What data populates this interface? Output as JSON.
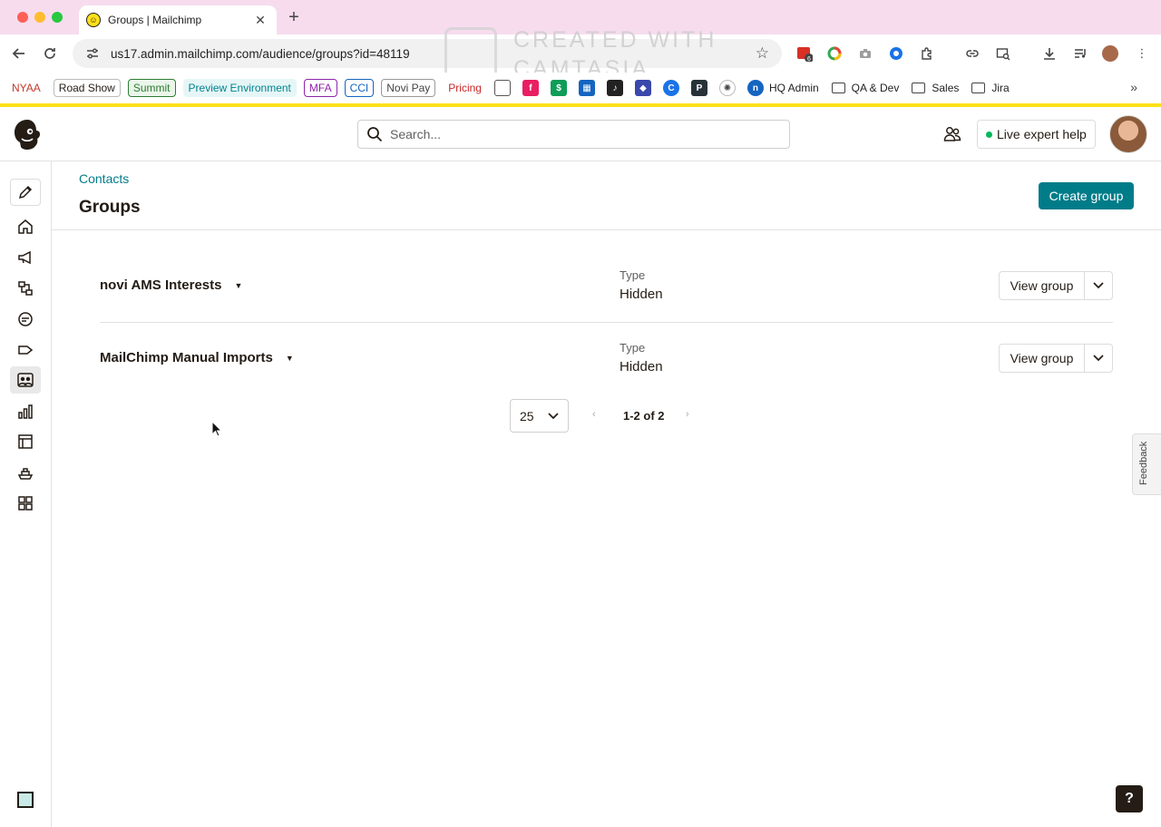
{
  "browser": {
    "tab_title": "Groups | Mailchimp",
    "url": "us17.admin.mailchimp.com/audience/groups?id=48119",
    "watermark_line1": "CREATED WITH",
    "watermark_line2": "CAMTASIA",
    "ext_badge": "6",
    "bookmarks": [
      {
        "label": "NYAA",
        "color": "#c0392b"
      },
      {
        "label": "Road Show",
        "color": "#241c15"
      },
      {
        "label": "Summit",
        "color": "#2e7d32"
      },
      {
        "label": "Preview Environment",
        "color": "#00838f"
      },
      {
        "label": "MFA",
        "color": "#8e24aa"
      },
      {
        "label": "CCI",
        "color": "#1565c0"
      },
      {
        "label": "Novi Pay",
        "color": "#424242"
      },
      {
        "label": "Pricing",
        "color": "#c62828"
      }
    ],
    "bookmark_folders": [
      "HQ Admin",
      "QA & Dev",
      "Sales",
      "Jira"
    ]
  },
  "header": {
    "search_placeholder": "Search...",
    "expert_help_label": "Live expert help"
  },
  "page": {
    "breadcrumb": "Contacts",
    "title": "Groups",
    "create_button": "Create group"
  },
  "groups": [
    {
      "name": "novi AMS Interests",
      "type_label": "Type",
      "type_value": "Hidden",
      "view_label": "View group"
    },
    {
      "name": "MailChimp Manual Imports",
      "type_label": "Type",
      "type_value": "Hidden",
      "view_label": "View group"
    }
  ],
  "pagination": {
    "per_page": "25",
    "range": "1-2 of 2"
  },
  "feedback_label": "Feedback",
  "help_label": "?",
  "colors": {
    "brand_teal": "#007c89",
    "brand_yellow": "#ffe01b",
    "text_dark": "#241c15"
  }
}
